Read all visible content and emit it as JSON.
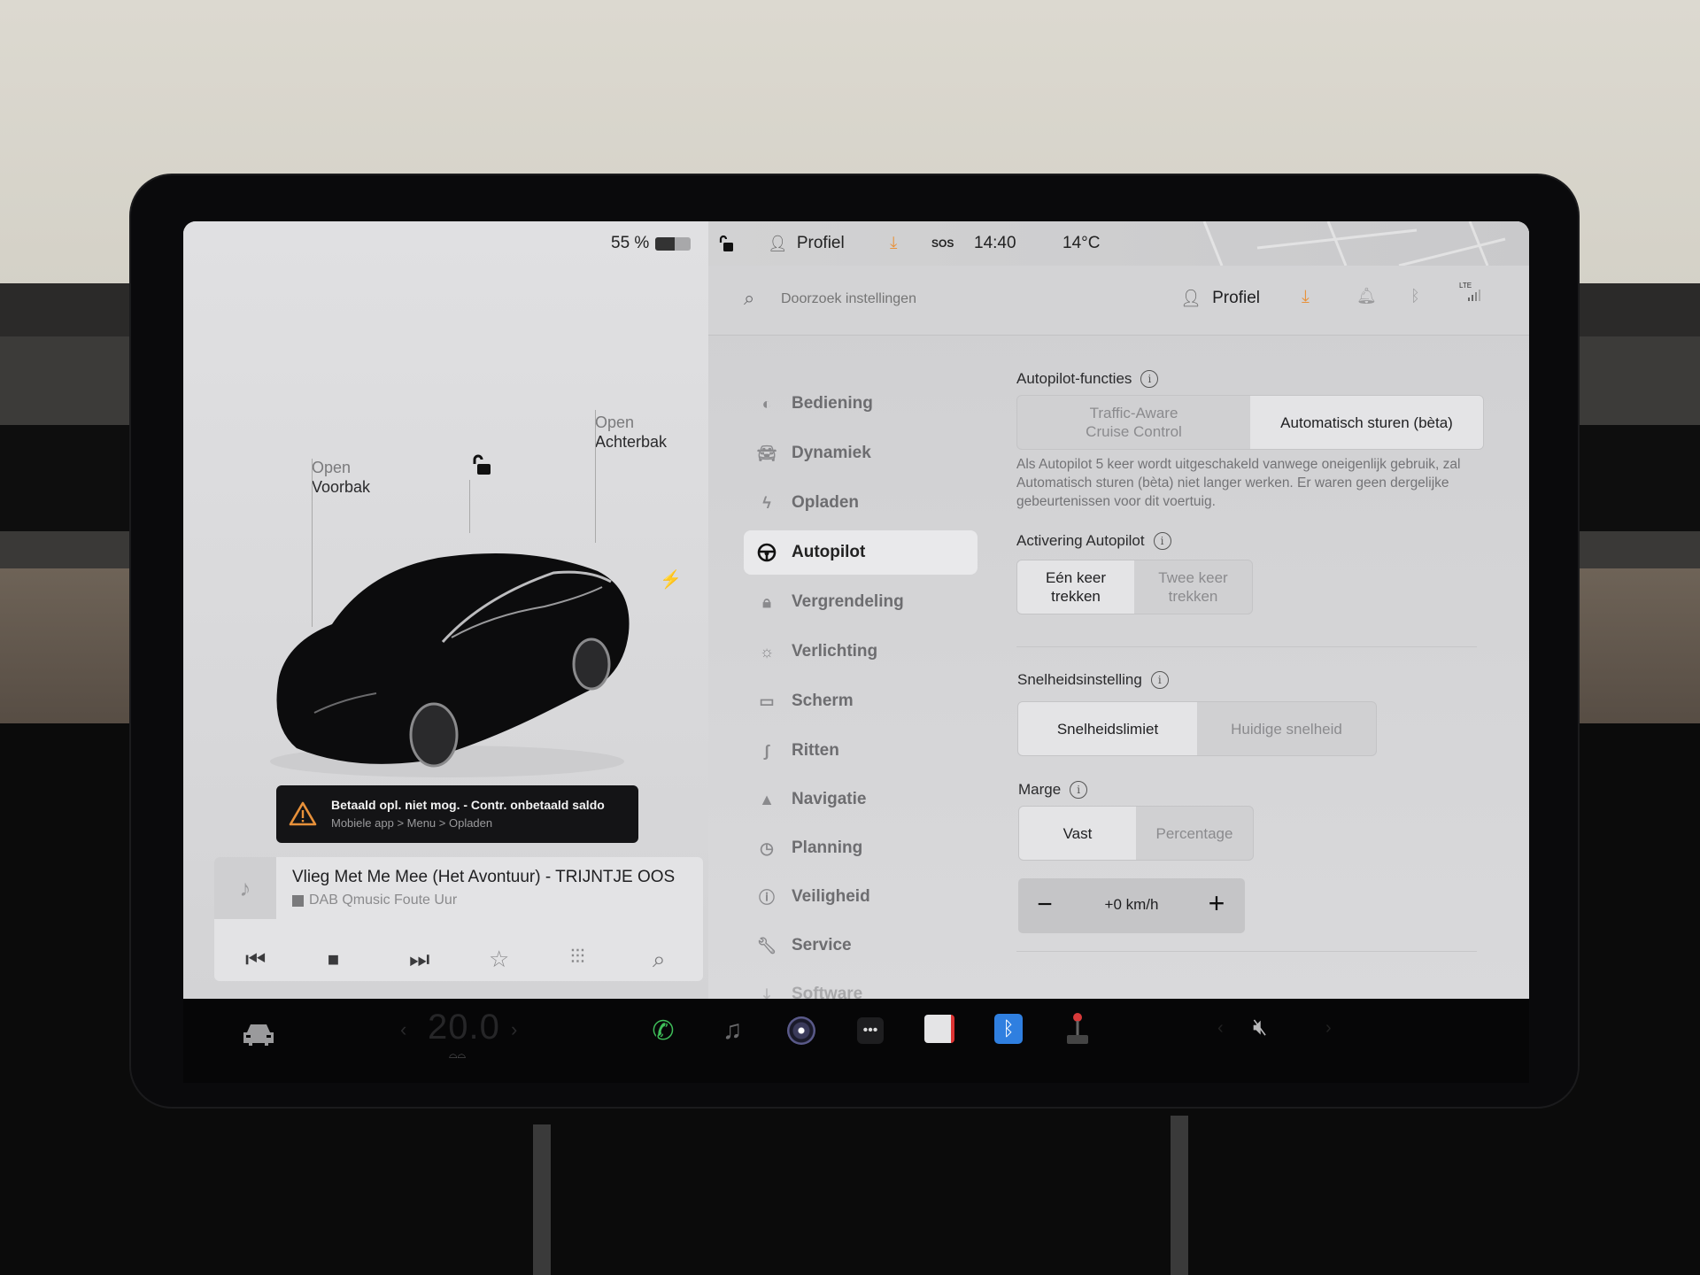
{
  "status_bar": {
    "battery_percent": "55 %",
    "battery_level": 0.55,
    "profile_label": "Profiel",
    "sos_label": "SOS",
    "time": "14:40",
    "outside_temp": "14°C"
  },
  "car_view": {
    "frunk_status": "Open",
    "frunk_label": "Voorbak",
    "trunk_status": "Open",
    "trunk_label": "Achterbak"
  },
  "alert": {
    "title": "Betaald opl. niet mog. - Contr. onbetaald saldo",
    "subtitle": "Mobiele app > Menu > Opladen"
  },
  "media": {
    "track_title": "Vlieg Met Me Mee (Het Avontuur) - TRIJNTJE OOS",
    "source": "DAB Qmusic Foute Uur"
  },
  "settings_header": {
    "search_placeholder": "Doorzoek instellingen",
    "profile_label": "Profiel",
    "network_label": "LTE"
  },
  "sidebar": {
    "items": [
      {
        "label": "Bediening",
        "icon": "toggle-icon"
      },
      {
        "label": "Dynamiek",
        "icon": "car-icon"
      },
      {
        "label": "Opladen",
        "icon": "bolt-icon"
      },
      {
        "label": "Autopilot",
        "icon": "steering-wheel-icon",
        "active": true
      },
      {
        "label": "Vergrendeling",
        "icon": "lock-icon"
      },
      {
        "label": "Verlichting",
        "icon": "light-icon"
      },
      {
        "label": "Scherm",
        "icon": "display-icon"
      },
      {
        "label": "Ritten",
        "icon": "trips-icon"
      },
      {
        "label": "Navigatie",
        "icon": "navigation-icon"
      },
      {
        "label": "Planning",
        "icon": "schedule-icon"
      },
      {
        "label": "Veiligheid",
        "icon": "safety-icon"
      },
      {
        "label": "Service",
        "icon": "wrench-icon"
      },
      {
        "label": "Software",
        "icon": "download-icon"
      }
    ]
  },
  "autopilot": {
    "features_title": "Autopilot-functies",
    "features_options": [
      "Traffic-Aware\nCruise Control",
      "Automatisch sturen (bèta)"
    ],
    "features_selected": 1,
    "features_desc": "Als Autopilot 5 keer wordt uitgeschakeld vanwege oneigenlijk gebruik, zal Automatisch sturen (bèta) niet langer werken. Er waren geen dergelijke gebeurtenissen voor dit voertuig.",
    "activation_title": "Activering Autopilot",
    "activation_options": [
      "Eén keer\ntrekken",
      "Twee keer\ntrekken"
    ],
    "activation_selected": 0,
    "speed_title": "Snelheidsinstelling",
    "speed_options": [
      "Snelheidslimiet",
      "Huidige snelheid"
    ],
    "speed_selected": 0,
    "margin_title": "Marge",
    "margin_options": [
      "Vast",
      "Percentage"
    ],
    "margin_selected": 0,
    "offset_value": "+0 km/h",
    "minus_label": "−",
    "plus_label": "+"
  },
  "dock": {
    "climate_temp": "20.0",
    "apps": [
      "phone-icon",
      "music-icon",
      "camera-icon",
      "more-icon",
      "calendar-icon",
      "bluetooth-icon",
      "toybox-icon"
    ],
    "volume": "muted"
  },
  "colors": {
    "accent_orange": "#e8913a",
    "phone_green": "#3fbf5a",
    "bluetooth_blue": "#2f7fe0"
  }
}
